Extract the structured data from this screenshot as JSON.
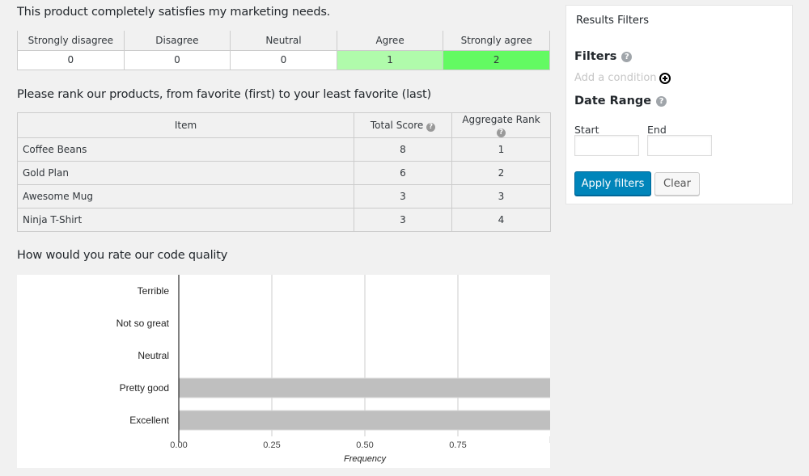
{
  "likert": {
    "question": "This product completely satisfies my marketing needs.",
    "headers": [
      "Strongly disagree",
      "Disagree",
      "Neutral",
      "Agree",
      "Strongly agree"
    ],
    "values": [
      "0",
      "0",
      "0",
      "1",
      "2"
    ],
    "cell_colors": [
      "#ffffff",
      "#ffffff",
      "#ffffff",
      "#b0fbab",
      "#63fa62"
    ]
  },
  "ranking": {
    "question": "Please rank our products, from favorite (first) to your least favorite (last)",
    "headers": {
      "item": "Item",
      "total_score": "Total Score",
      "aggregate_rank": "Aggregate Rank"
    },
    "help_icon": "question-circle-icon",
    "rows": [
      {
        "item": "Coffee Beans",
        "total_score": "8",
        "aggregate_rank": "1"
      },
      {
        "item": "Gold Plan",
        "total_score": "6",
        "aggregate_rank": "2"
      },
      {
        "item": "Awesome Mug",
        "total_score": "3",
        "aggregate_rank": "3"
      },
      {
        "item": "Ninja T-Shirt",
        "total_score": "3",
        "aggregate_rank": "4"
      }
    ]
  },
  "code_quality": {
    "question": "How would you rate our code quality"
  },
  "chart_data": {
    "type": "bar",
    "orientation": "horizontal",
    "title": "",
    "categories": [
      "Terrible",
      "Not so great",
      "Neutral",
      "Pretty good",
      "Excellent"
    ],
    "values": [
      0,
      0,
      0,
      1,
      1
    ],
    "xlabel": "Frequency",
    "ylabel": "",
    "xlim": [
      0,
      1
    ],
    "xticks": [
      "0.00",
      "0.25",
      "0.50",
      "0.75"
    ],
    "grid": true,
    "bar_color": "#bfbfbf"
  },
  "filters": {
    "panel_title": "Results Filters",
    "filters_heading": "Filters",
    "add_condition": "Add a condition",
    "date_range_heading": "Date Range",
    "start_label": "Start",
    "end_label": "End",
    "start_value": "",
    "end_value": "",
    "apply_label": "Apply filters",
    "clear_label": "Clear",
    "accent": "#0085ba"
  }
}
